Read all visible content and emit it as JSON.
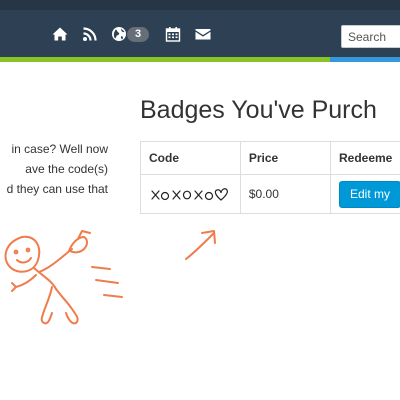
{
  "navbar": {
    "icons": [
      "home-icon",
      "rss-icon",
      "globe-icon",
      "calendar-icon",
      "envelope-icon"
    ],
    "globe_badge": "3",
    "search_placeholder": "Search",
    "colors": {
      "background": "#2e4053",
      "accent_green": "#88c425",
      "accent_blue": "#3598db"
    }
  },
  "sidebar": {
    "intro_lines": [
      "in case? Well now",
      "ave the code(s)",
      "d they can use that"
    ]
  },
  "main": {
    "title": "Badges You've Purch",
    "table": {
      "headers": [
        "Code",
        "Price",
        "Redeeme"
      ],
      "rows": [
        {
          "code": "XoXoXo♡",
          "price": "$0.00",
          "action_label": "Edit my"
        }
      ]
    },
    "button_color": "#0099d8"
  }
}
